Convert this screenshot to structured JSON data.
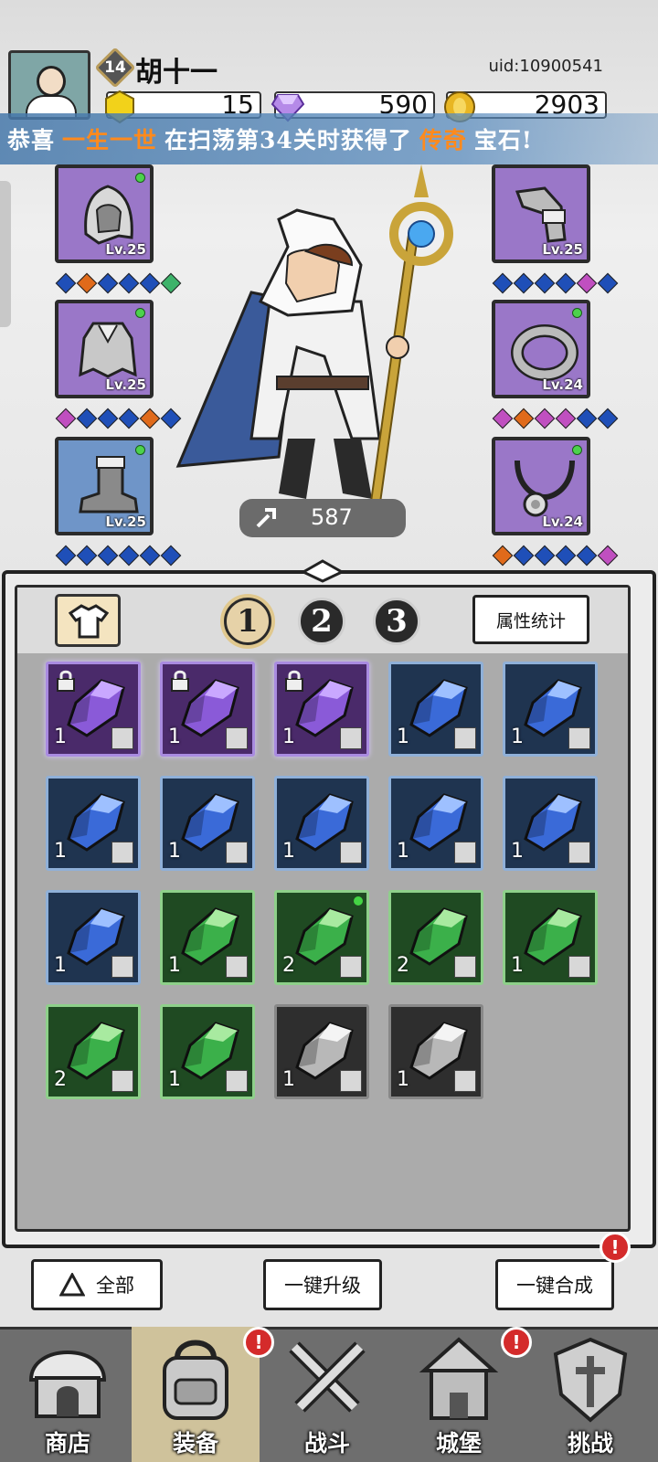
{
  "header": {
    "level": "14",
    "player_name": "胡十一",
    "uid": "uid:10900541",
    "resources": [
      {
        "icon": "gold-shield-icon",
        "value": "15"
      },
      {
        "icon": "purple-diamond-icon",
        "value": "590"
      },
      {
        "icon": "gold-coin-icon",
        "value": "2903"
      }
    ]
  },
  "banner": {
    "prefix": "恭喜",
    "name": "一生一世",
    "middle": "在扫荡第34关时获得了",
    "item": "传奇",
    "suffix": "宝石!"
  },
  "equipment": {
    "left": [
      {
        "name": "hood",
        "level": "Lv.25",
        "rarity": "purple"
      },
      {
        "name": "cape",
        "level": "Lv.25",
        "rarity": "purple"
      },
      {
        "name": "boots",
        "level": "Lv.25",
        "rarity": "blue"
      }
    ],
    "right": [
      {
        "name": "bracer",
        "level": "Lv.25",
        "rarity": "purple"
      },
      {
        "name": "ring",
        "level": "Lv.24",
        "rarity": "purple"
      },
      {
        "name": "necklace",
        "level": "Lv.24",
        "rarity": "purple"
      }
    ],
    "gem_rows": {
      "left": [
        [
          "#1f4fb8",
          "#e06a1a",
          "#1f4fb8",
          "#1f4fb8",
          "#1f4fb8",
          "#3db36a"
        ],
        [
          "#c04fc0",
          "#1f4fb8",
          "#1f4fb8",
          "#1f4fb8",
          "#e06a1a",
          "#1f4fb8"
        ],
        [
          "#1f4fb8",
          "#1f4fb8",
          "#1f4fb8",
          "#1f4fb8",
          "#1f4fb8",
          "#1f4fb8"
        ]
      ],
      "right": [
        [
          "#1f4fb8",
          "#1f4fb8",
          "#1f4fb8",
          "#1f4fb8",
          "#c04fc0",
          "#1f4fb8"
        ],
        [
          "#c04fc0",
          "#e06a1a",
          "#c04fc0",
          "#c04fc0",
          "#1f4fb8",
          "#1f4fb8"
        ],
        [
          "#e06a1a",
          "#1f4fb8",
          "#1f4fb8",
          "#1f4fb8",
          "#1f4fb8",
          "#c04fc0"
        ]
      ]
    }
  },
  "power": "587",
  "panel": {
    "pages": [
      "1",
      "2",
      "3"
    ],
    "active_page": "1",
    "stats_button": "属性统计"
  },
  "gems": [
    {
      "color": "purple",
      "count": "1",
      "slot": "boots",
      "locked": true
    },
    {
      "color": "purple",
      "count": "1",
      "slot": "necklace",
      "locked": true
    },
    {
      "color": "purple",
      "count": "1",
      "slot": "necklace",
      "locked": true
    },
    {
      "color": "blue",
      "count": "1",
      "slot": "ring"
    },
    {
      "color": "blue",
      "count": "1",
      "slot": "cape"
    },
    {
      "color": "blue",
      "count": "1",
      "slot": "bracer"
    },
    {
      "color": "blue",
      "count": "1",
      "slot": "bracer"
    },
    {
      "color": "blue",
      "count": "1",
      "slot": "bracer"
    },
    {
      "color": "blue",
      "count": "1",
      "slot": "ring"
    },
    {
      "color": "blue",
      "count": "1",
      "slot": "necklace"
    },
    {
      "color": "blue",
      "count": "1",
      "slot": "necklace"
    },
    {
      "color": "green",
      "count": "1",
      "slot": "cape"
    },
    {
      "color": "green",
      "count": "2",
      "slot": "bracer",
      "new": true
    },
    {
      "color": "green",
      "count": "2",
      "slot": "bracer"
    },
    {
      "color": "green",
      "count": "1",
      "slot": "bracer"
    },
    {
      "color": "green",
      "count": "2",
      "slot": "ring"
    },
    {
      "color": "green",
      "count": "1",
      "slot": "necklace"
    },
    {
      "color": "gray",
      "count": "1",
      "slot": "boots"
    },
    {
      "color": "gray",
      "count": "1",
      "slot": "necklace"
    }
  ],
  "actions": {
    "filter_all": "全部",
    "upgrade_all": "一键升级",
    "merge_all": "一键合成"
  },
  "nav": [
    {
      "label": "商店",
      "icon": "shop-icon"
    },
    {
      "label": "装备",
      "icon": "backpack-icon",
      "active": true
    },
    {
      "label": "战斗",
      "icon": "crossed-swords-icon"
    },
    {
      "label": "城堡",
      "icon": "castle-icon"
    },
    {
      "label": "挑战",
      "icon": "shield-icon"
    }
  ],
  "colors": {
    "purple_gem": "#8a5ad8",
    "blue_gem": "#3a6ad8",
    "green_gem": "#3bb04a",
    "gray_gem": "#d8d8d8",
    "banner_highlight": "#ff8a1d",
    "alert": "#d42b2b"
  }
}
